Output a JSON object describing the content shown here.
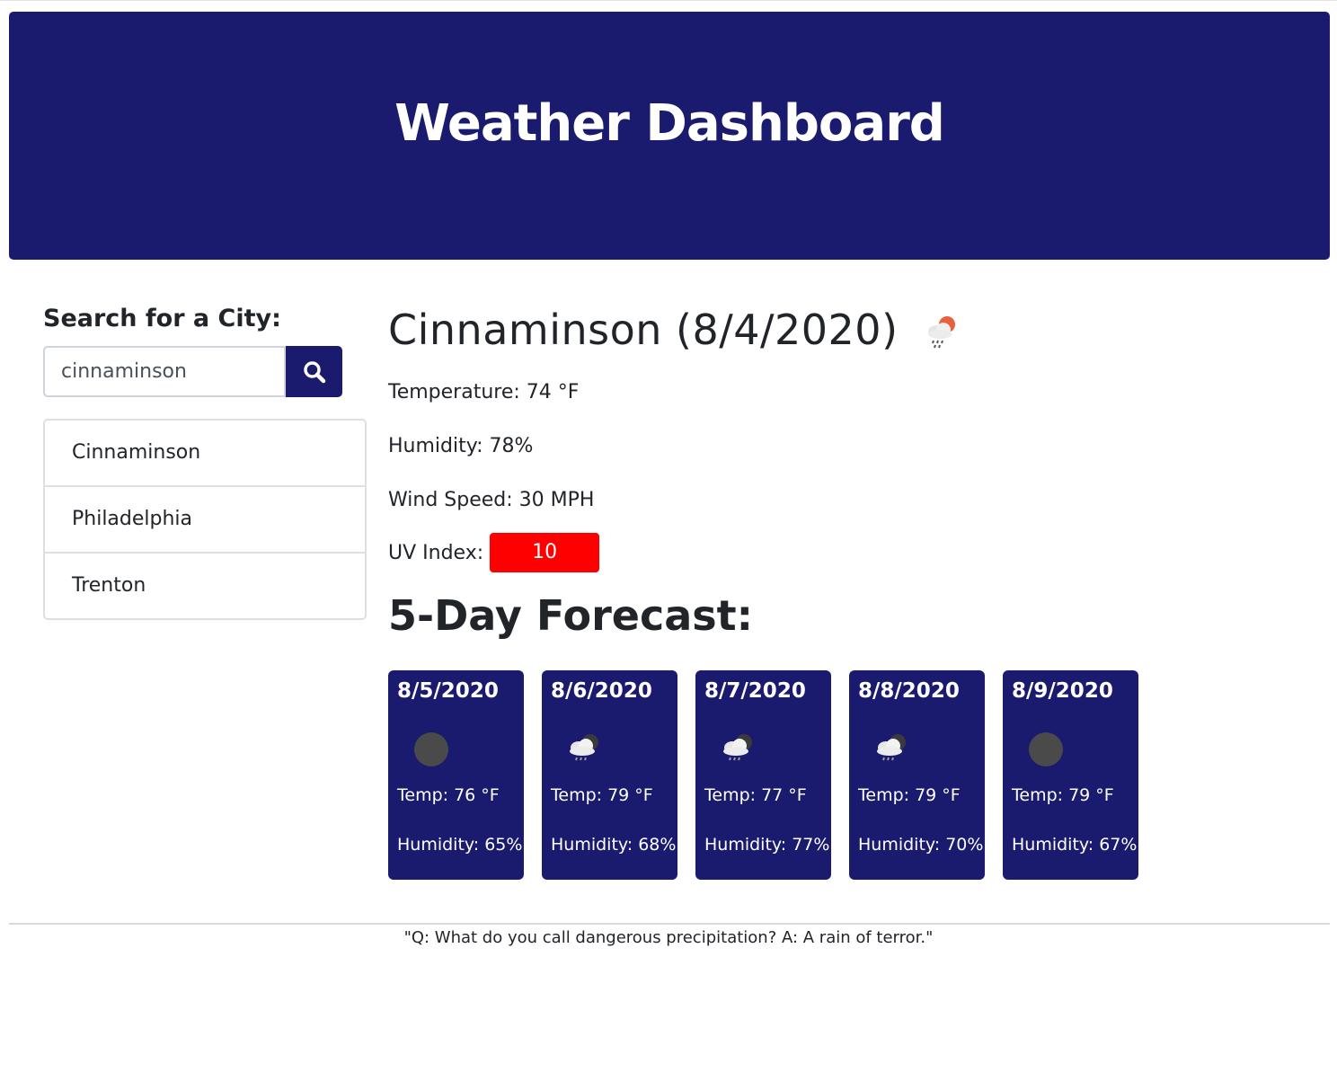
{
  "header": {
    "title": "Weather Dashboard"
  },
  "search": {
    "label": "Search for a City:",
    "value": "cinnaminson",
    "button_icon": "search-icon"
  },
  "history": [
    {
      "label": "Cinnaminson"
    },
    {
      "label": "Philadelphia"
    },
    {
      "label": "Trenton"
    }
  ],
  "current": {
    "title": "Cinnaminson (8/4/2020)",
    "icon": "rain-cloud-sun-icon",
    "temperature": "Temperature: 74 °F",
    "humidity": "Humidity: 78%",
    "wind": "Wind Speed: 30 MPH",
    "uv_label": "UV Index:",
    "uv_value": "10",
    "uv_color": "#ff0000"
  },
  "forecast": {
    "title": "5-Day Forecast:",
    "days": [
      {
        "date": "8/5/2020",
        "icon": "moon-icon",
        "temp": "Temp: 76 °F",
        "humidity": "Humidity: 65%"
      },
      {
        "date": "8/6/2020",
        "icon": "rain-cloud-moon-icon",
        "temp": "Temp: 79 °F",
        "humidity": "Humidity: 68%"
      },
      {
        "date": "8/7/2020",
        "icon": "rain-cloud-moon-icon",
        "temp": "Temp: 77 °F",
        "humidity": "Humidity: 77%"
      },
      {
        "date": "8/8/2020",
        "icon": "rain-cloud-moon-icon",
        "temp": "Temp: 79 °F",
        "humidity": "Humidity: 70%"
      },
      {
        "date": "8/9/2020",
        "icon": "moon-icon",
        "temp": "Temp: 79 °F",
        "humidity": "Humidity: 67%"
      }
    ]
  },
  "footer": {
    "quote": "\"Q: What do you call dangerous precipitation? A: A rain of terror.\""
  },
  "colors": {
    "brand": "#1a1a6e",
    "uv_high": "#ff0000"
  }
}
